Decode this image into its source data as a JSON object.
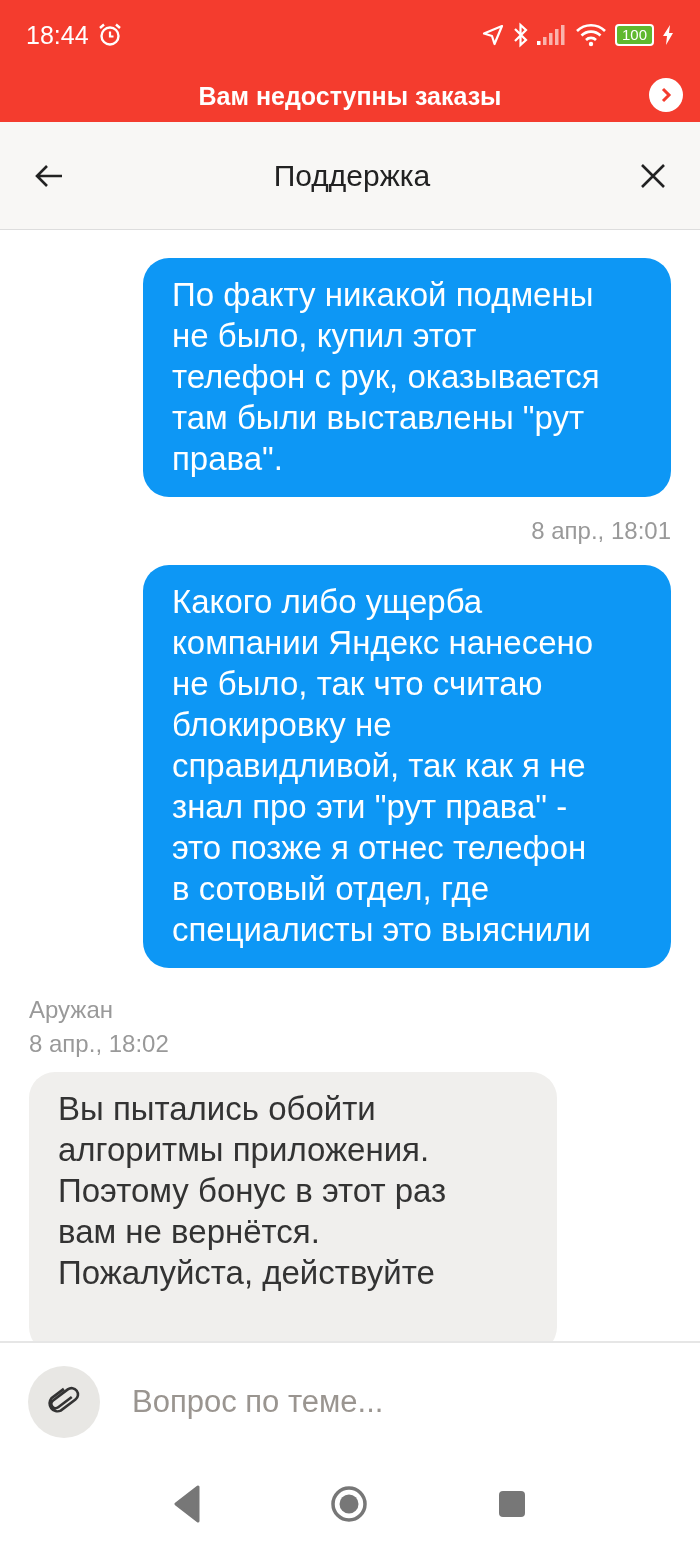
{
  "status_bar": {
    "time": "18:44",
    "battery": "100"
  },
  "banner": {
    "text": "Вам недоступны заказы"
  },
  "header": {
    "title": "Поддержка"
  },
  "messages": [
    {
      "kind": "outgoing",
      "text": "По факту никакой подмены\nне было, купил этот\nтелефон с рук, оказывается\nтам были выставлены \"рут\nправа\"."
    },
    {
      "kind": "timestamp",
      "text": "8 апр., 18:01"
    },
    {
      "kind": "outgoing",
      "text": "Какого либо ущерба\nкомпании Яндекс нанесено\nне было, так что считаю\nблокировку не\nсправидливой, так как я не\nзнал про эти \"рут права\" -\nэто позже я отнес телефон\nв сотовый отдел, где\nспециалисты это выяснили"
    },
    {
      "kind": "sender",
      "name": "Аружан",
      "time": "8 апр., 18:02"
    },
    {
      "kind": "incoming",
      "text": "Вы пытались обойти\nалгоритмы приложения.\nПоэтому бонус в этот раз\nвам не вернётся.\nПожалуйста, действуйте"
    }
  ],
  "input": {
    "placeholder": "Вопрос по теме..."
  }
}
